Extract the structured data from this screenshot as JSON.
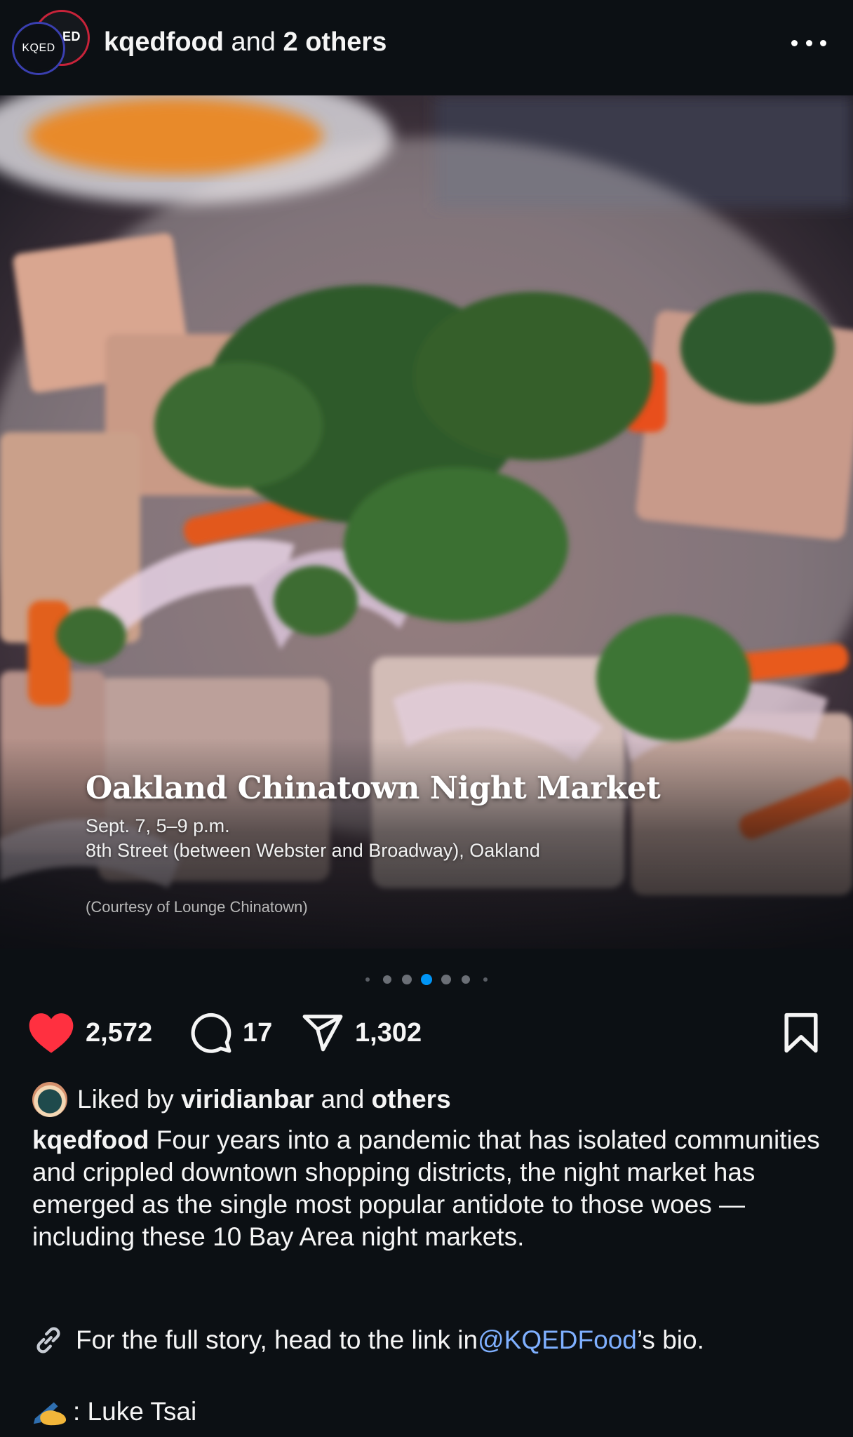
{
  "header": {
    "avatar_back_text": "ED",
    "avatar_front_text": "KQED",
    "account": "kqedfood",
    "connector": " and ",
    "others": "2 others"
  },
  "media": {
    "title": "Oakland Chinatown Night Market",
    "date": "Sept. 7, 5–9 p.m.",
    "location": "8th Street (between Webster and Broadway), Oakland",
    "credit": "(Courtesy of Lounge Chinatown)"
  },
  "carousel": {
    "total": 7,
    "active_index": 4
  },
  "actions": {
    "likes": "2,572",
    "comments": "17",
    "shares": "1,302"
  },
  "liked_by": {
    "prefix": "Liked by ",
    "user": "viridianbar",
    "connector": " and ",
    "others": "others"
  },
  "caption": {
    "author": "kqedfood",
    "text": " Four years into a pandemic that has isolated communities and crippled downtown shopping districts, the night market has emerged as the single most popular antidote to those woes — including these 10 Bay Area night markets.",
    "link_prefix": "For the full story, head to the link in ",
    "mention": "@KQEDFood",
    "link_suffix": "’s bio.",
    "author_credit": ": Luke Tsai"
  },
  "colors": {
    "background": "#0c1014",
    "heart": "#ff3040",
    "active_dot": "#0095f6",
    "mention": "#7fb0ff"
  },
  "icons": [
    "more-icon",
    "heart-icon",
    "comment-icon",
    "share-icon",
    "bookmark-icon",
    "link-icon",
    "writing-hand-icon"
  ]
}
